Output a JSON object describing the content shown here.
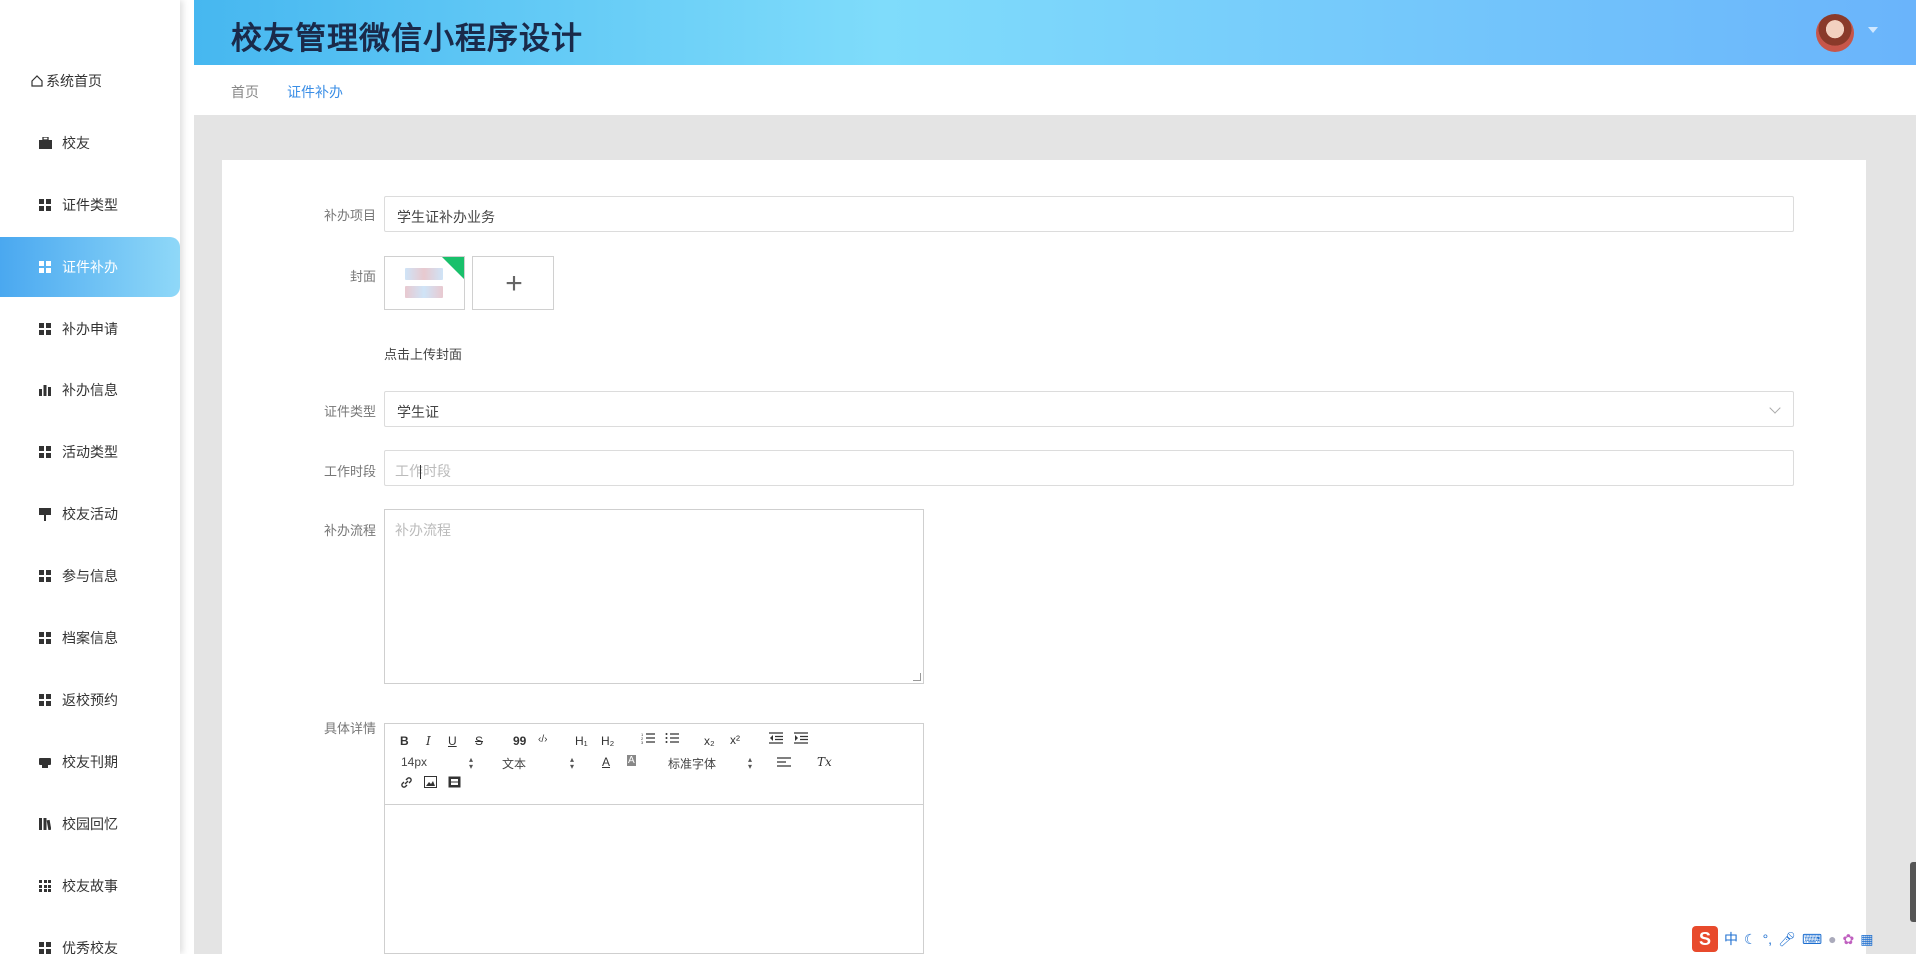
{
  "app": {
    "title": "校友管理微信小程序设计"
  },
  "sidebar": {
    "items": [
      {
        "label": "系统首页",
        "icon": "home-icon"
      },
      {
        "label": "校友",
        "icon": "briefcase-icon"
      },
      {
        "label": "证件类型",
        "icon": "grid-icon"
      },
      {
        "label": "证件补办",
        "icon": "grid-icon",
        "active": true
      },
      {
        "label": "补办申请",
        "icon": "grid-icon"
      },
      {
        "label": "补办信息",
        "icon": "bar-chart-icon"
      },
      {
        "label": "活动类型",
        "icon": "grid-icon"
      },
      {
        "label": "校友活动",
        "icon": "flag-icon"
      },
      {
        "label": "参与信息",
        "icon": "grid-icon"
      },
      {
        "label": "档案信息",
        "icon": "grid-icon"
      },
      {
        "label": "返校预约",
        "icon": "grid-icon"
      },
      {
        "label": "校友刊期",
        "icon": "printer-icon"
      },
      {
        "label": "校园回忆",
        "icon": "library-icon"
      },
      {
        "label": "校友故事",
        "icon": "grid9-icon"
      },
      {
        "label": "优秀校友",
        "icon": "grid-icon"
      }
    ]
  },
  "breadcrumb": {
    "home": "首页",
    "current": "证件补办"
  },
  "form": {
    "project": {
      "label": "补办项目",
      "value": "学生证补办业务"
    },
    "cover": {
      "label": "封面",
      "hint": "点击上传封面",
      "add": "+"
    },
    "cert_type": {
      "label": "证件类型",
      "value": "学生证"
    },
    "work_time": {
      "label": "工作时段",
      "placeholder": "工作时段"
    },
    "process": {
      "label": "补办流程",
      "placeholder": "补办流程"
    },
    "details": {
      "label": "具体详情"
    }
  },
  "editor": {
    "font_size": "14px",
    "block_type": "文本",
    "font_family": "标准字体",
    "buttons": {
      "bold": "B",
      "italic": "I",
      "underline": "U",
      "strike": "S",
      "quote": "99",
      "code": "‹/›",
      "h1": "H₁",
      "h2": "H₂",
      "sub": "x₂",
      "sup": "x²",
      "color": "A",
      "bg": "A",
      "clean": "Tx"
    }
  },
  "ime": {
    "lang": "中"
  },
  "colors": {
    "accent": "#3a8ee6",
    "active_start": "#4aa8f0",
    "active_end": "#8fd8f8"
  }
}
